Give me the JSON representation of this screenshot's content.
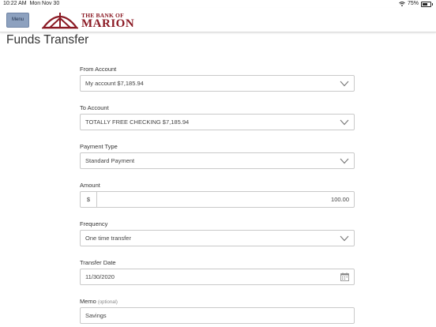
{
  "status_bar": {
    "time": "10:22 AM",
    "date": "Mon Nov 30",
    "battery": "75%"
  },
  "header": {
    "menu_label": "Menu",
    "logo_top": "THE BANK OF",
    "logo_bottom": "MARION"
  },
  "page": {
    "title": "Funds Transfer"
  },
  "form": {
    "from_account": {
      "label": "From Account",
      "value": "My account $7,185.94"
    },
    "to_account": {
      "label": "To Account",
      "value": "TOTALLY FREE CHECKING $7,185.94"
    },
    "payment_type": {
      "label": "Payment Type",
      "value": "Standard Payment"
    },
    "amount": {
      "label": "Amount",
      "prefix": "$",
      "value": "100.00"
    },
    "frequency": {
      "label": "Frequency",
      "value": "One time transfer"
    },
    "transfer_date": {
      "label": "Transfer Date",
      "value": "11/30/2020"
    },
    "memo": {
      "label": "Memo",
      "optional": "(optional)",
      "value": "Savings"
    }
  },
  "colors": {
    "brand": "#8b1a24",
    "menu_button": "#8da1bf",
    "border": "#c9c9c9"
  }
}
